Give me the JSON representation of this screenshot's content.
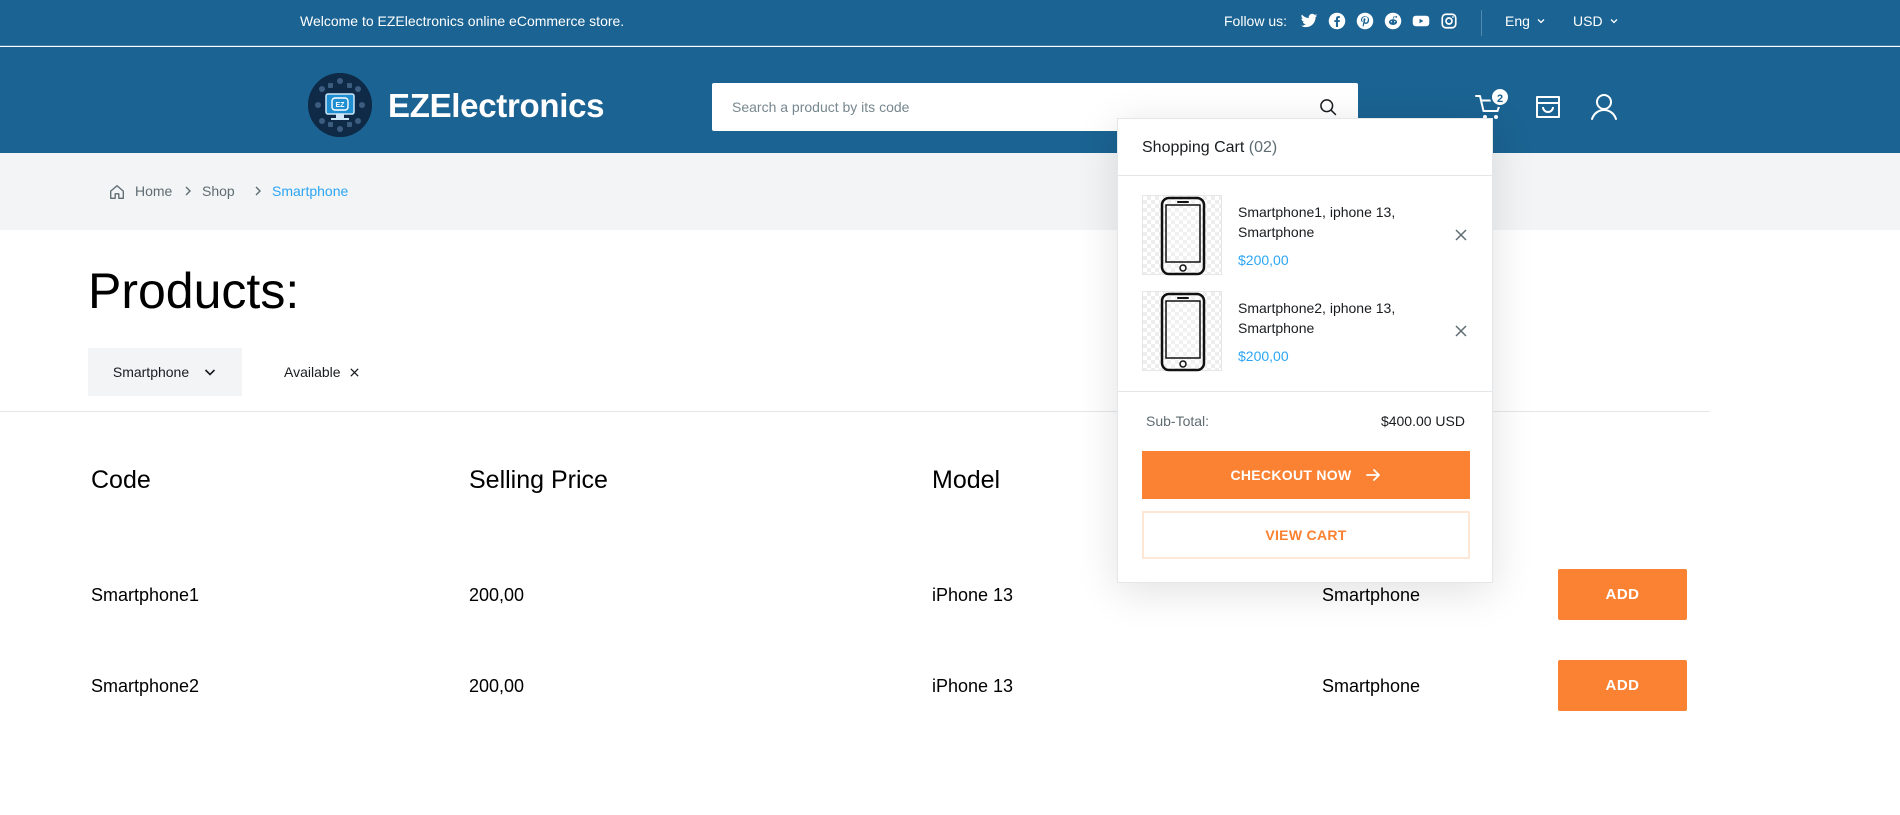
{
  "topbar": {
    "welcome": "Welcome to EZElectronics online eCommerce store.",
    "follow_label": "Follow us:",
    "social_icons": [
      "twitter-icon",
      "facebook-icon",
      "pinterest-icon",
      "reddit-icon",
      "youtube-icon",
      "instagram-icon"
    ],
    "language": "Eng",
    "currency": "USD"
  },
  "header": {
    "logo_text": "EZElectronics",
    "search_placeholder": "Search a product by its code",
    "cart_count": "2"
  },
  "breadcrumb": {
    "items": [
      "Home",
      "Shop",
      "Smartphone"
    ]
  },
  "main": {
    "title": "Products:",
    "filter_category": "Smartphone",
    "filter_chip": "Available",
    "table": {
      "headers": [
        "Code",
        "Selling Price",
        "Model"
      ],
      "rows": [
        {
          "code": "Smartphone1",
          "price": "200,00",
          "model": "iPhone 13",
          "category": "Smartphone",
          "action": "ADD"
        },
        {
          "code": "Smartphone2",
          "price": "200,00",
          "model": "iPhone 13",
          "category": "Smartphone",
          "action": "ADD"
        }
      ]
    }
  },
  "cart": {
    "title": "Shopping Cart",
    "count": "(02)",
    "items": [
      {
        "name": "Smartphone1, iphone 13, Smartphone",
        "price": "$200,00"
      },
      {
        "name": "Smartphone2, iphone 13, Smartphone",
        "price": "$200,00"
      }
    ],
    "subtotal_label": "Sub-Total:",
    "subtotal_value": "$400.00 USD",
    "checkout_label": "CHECKOUT NOW",
    "view_cart_label": "VIEW CART"
  },
  "colors": {
    "brand_blue": "#1b6392",
    "accent_orange": "#fa8232",
    "link_blue": "#2da5f3",
    "breadcrumb_bg": "#f2f4f5"
  }
}
